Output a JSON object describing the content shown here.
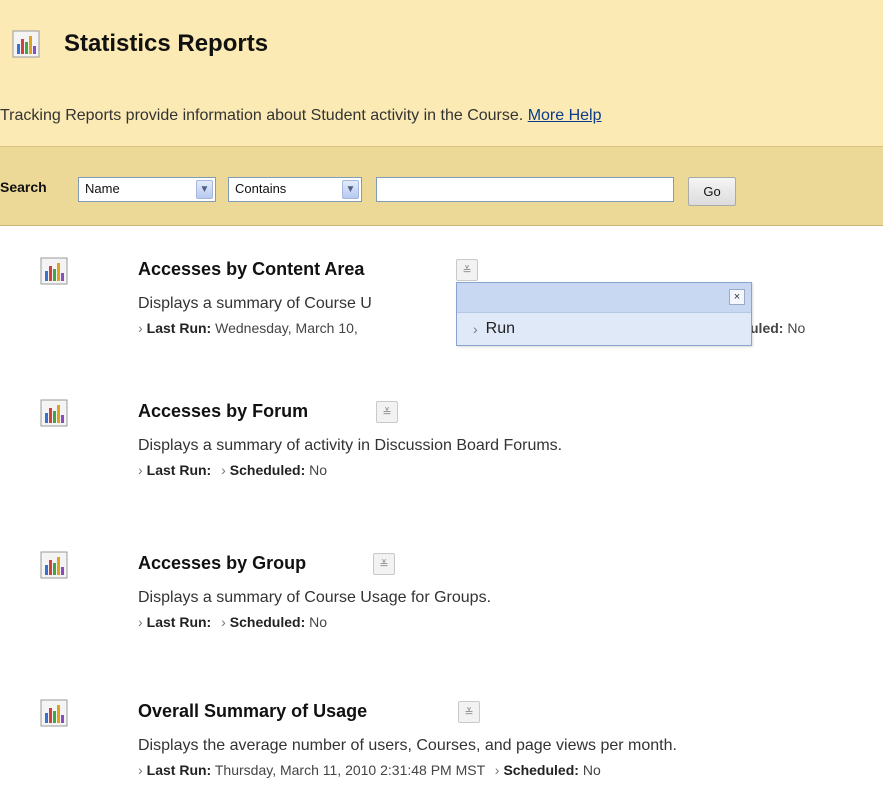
{
  "header": {
    "icon": "report-chart-icon",
    "title": "Statistics Reports",
    "description": "Tracking Reports provide information about Student activity in the Course.",
    "help_link": "More Help"
  },
  "search": {
    "label": "Search",
    "field_selected": "Name",
    "operator_selected": "Contains",
    "query_value": "",
    "go_label": "Go"
  },
  "reports": [
    {
      "title": "Accesses by Content Area",
      "description": "Displays a summary of Course U",
      "last_run_label": "Last Run:",
      "last_run_value": "Wednesday, March 10,",
      "scheduled_label": "uled:",
      "scheduled_value": "No"
    },
    {
      "title": "Accesses by Forum",
      "description": "Displays a summary of activity in Discussion Board Forums.",
      "last_run_label": "Last Run:",
      "last_run_value": "",
      "scheduled_label": "Scheduled:",
      "scheduled_value": "No"
    },
    {
      "title": "Accesses by Group",
      "description": "Displays a summary of Course Usage for Groups.",
      "last_run_label": "Last Run:",
      "last_run_value": "",
      "scheduled_label": "Scheduled:",
      "scheduled_value": "No"
    },
    {
      "title": "Overall Summary of Usage",
      "description": "Displays the average number of users, Courses, and page views per month.",
      "last_run_label": "Last Run:",
      "last_run_value": "Thursday, March 11, 2010 2:31:48 PM MST",
      "scheduled_label": "Scheduled:",
      "scheduled_value": "No"
    }
  ],
  "popup": {
    "close_symbol": "×",
    "run_label": "Run"
  }
}
